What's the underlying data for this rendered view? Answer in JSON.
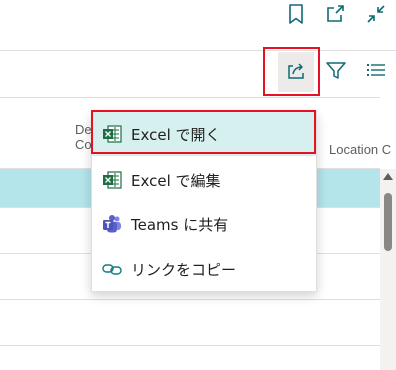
{
  "top_actions": {
    "bookmark_icon": "bookmark-icon",
    "open_new_window_icon": "open-in-new-window-icon",
    "collapse_icon": "collapse-icon"
  },
  "toolbar": {
    "share_icon": "share-icon",
    "filter_icon": "filter-icon",
    "list_view_icon": "list-view-icon"
  },
  "grid": {
    "columns": [
      {
        "label_line1": "De",
        "label_line2": "Co"
      },
      {
        "label_line1": "Location C",
        "label_line2": ""
      }
    ]
  },
  "share_menu": {
    "items": [
      {
        "label": "Excel で開く",
        "icon": "excel-icon"
      },
      {
        "label": "Excel で編集",
        "icon": "excel-icon"
      },
      {
        "label": "Teams に共有",
        "icon": "teams-icon"
      },
      {
        "label": "リンクをコピー",
        "icon": "link-icon"
      }
    ]
  },
  "colors": {
    "highlight": "#e81123",
    "selected_row": "#b3e5ea",
    "active_menu_item": "#d6efef",
    "excel_green": "#1d6f42",
    "teams_purple": "#5b5fc7",
    "link_teal": "#107c83"
  }
}
